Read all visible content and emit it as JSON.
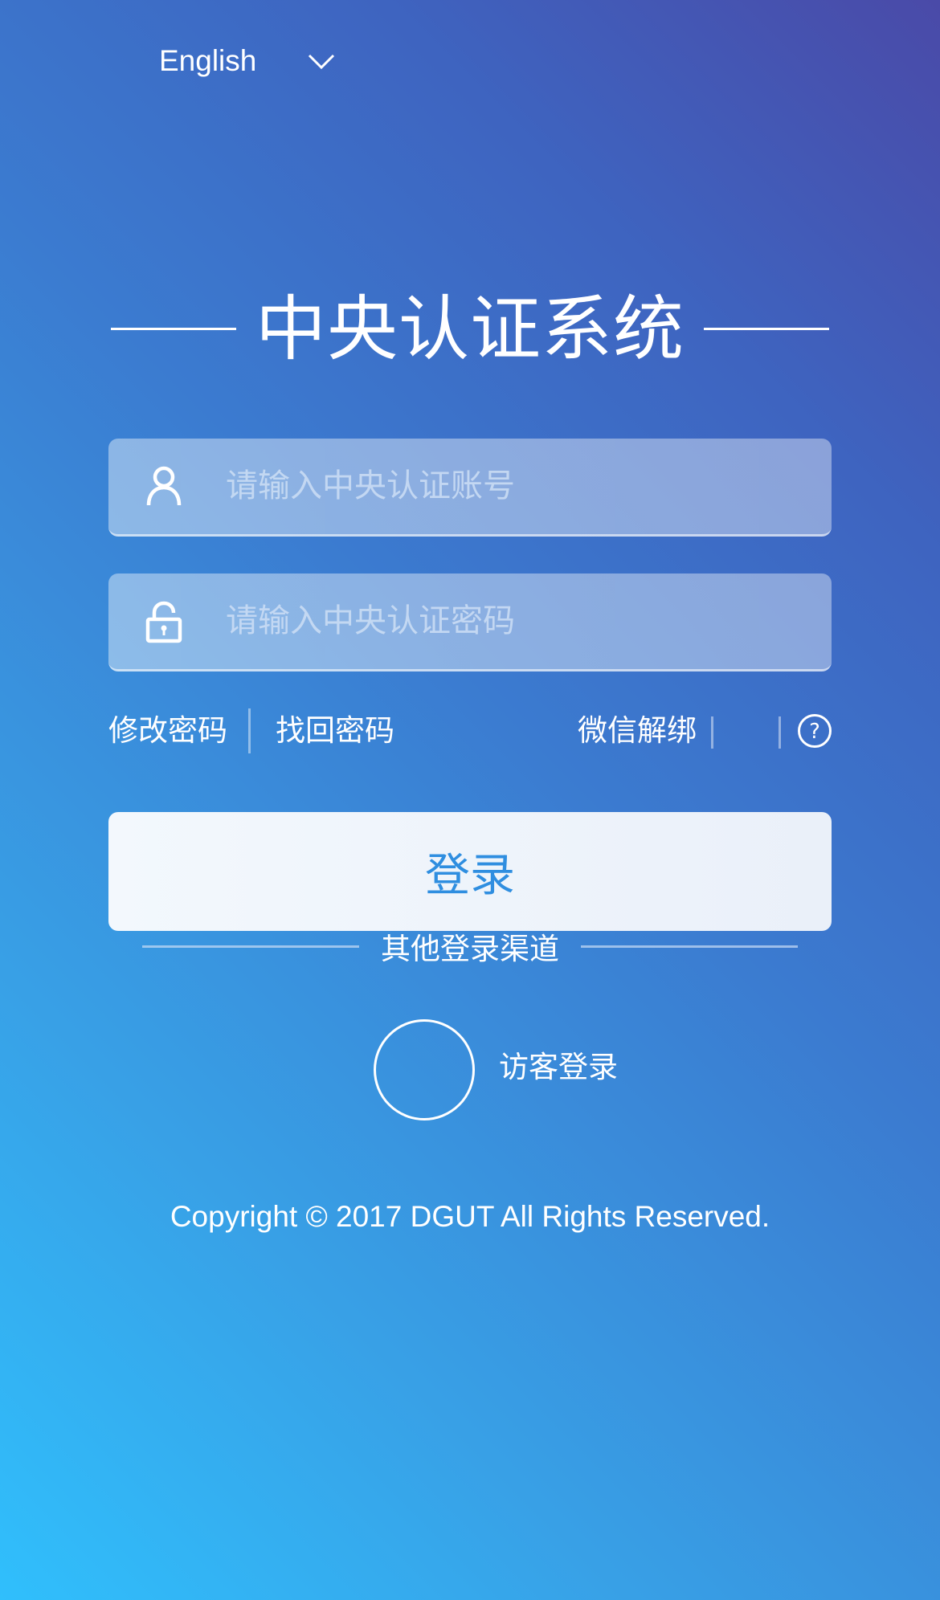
{
  "language": {
    "selected": "English",
    "icon": "chevron-down-icon"
  },
  "title": "中央认证系统",
  "form": {
    "username": {
      "placeholder": "请输入中央认证账号",
      "value": "",
      "icon": "user-icon"
    },
    "password": {
      "placeholder": "请输入中央认证密码",
      "value": "",
      "icon": "lock-icon"
    }
  },
  "links": {
    "change_password": "修改密码",
    "recover_password": "找回密码",
    "wechat_unbind": "微信解绑",
    "help_icon": "question-circle-icon"
  },
  "login_button": "登录",
  "other_login": {
    "heading": "其他登录渠道",
    "guest_label": "访客登录"
  },
  "footer": {
    "copyright": "Copyright © 2017 DGUT All Rights Reserved."
  },
  "colors": {
    "background_top_right": "#4a4aa8",
    "background_bottom_left": "#30bffc",
    "login_text": "#2f8ee0",
    "text": "#ffffff"
  }
}
